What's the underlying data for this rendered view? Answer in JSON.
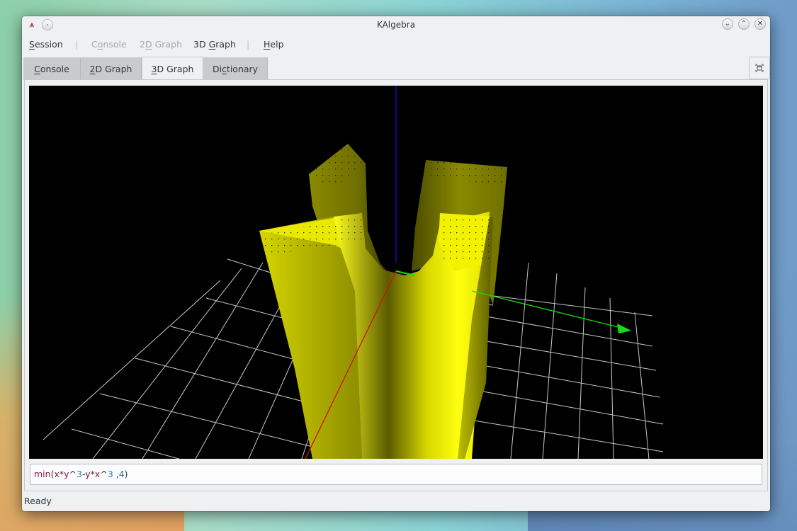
{
  "window": {
    "title": "KAlgebra",
    "app_icon": "kalgebra-logo-icon",
    "buttons": {
      "minimize": "⌄",
      "maximize": "⌃",
      "close": "✕"
    }
  },
  "menubar": {
    "items": [
      {
        "label": "Session",
        "mnemonic": "S",
        "rest": "ession",
        "enabled": true
      },
      {
        "label": "Console",
        "pre": "C",
        "mnemonic": "o",
        "rest": "nsole",
        "enabled": false
      },
      {
        "label": "2D Graph",
        "pre": "2",
        "mnemonic": "D",
        "rest": " Graph",
        "enabled": false
      },
      {
        "label": "3D Graph",
        "pre": "3D ",
        "mnemonic": "G",
        "rest": "raph",
        "enabled": true
      },
      {
        "label": "Help",
        "mnemonic": "H",
        "rest": "elp",
        "enabled": true
      }
    ],
    "separator": "|"
  },
  "tabs": {
    "active": "3D Graph",
    "items": [
      {
        "label": "Console",
        "mnemonic": "C",
        "rest": "onsole"
      },
      {
        "label": "2D Graph",
        "mnemonic": "2",
        "rest": "D Graph"
      },
      {
        "label": "3D Graph",
        "mnemonic": "3",
        "rest": "D Graph"
      },
      {
        "label": "Dictionary",
        "pre": "Di",
        "mnemonic": "c",
        "rest": "tionary"
      }
    ]
  },
  "graph3d": {
    "function": "min(x*y^3-y*x^3 ,4)",
    "colors": {
      "background": "#000000",
      "surface": "#ffff00",
      "x_axis": "#d01010",
      "y_axis": "#10e010",
      "z_axis": "#1010b0",
      "grid": "#c8c8c8"
    }
  },
  "expression": {
    "tokens": [
      {
        "t": "min",
        "c": "t-fn"
      },
      {
        "t": "(",
        "c": "t-op"
      },
      {
        "t": "x",
        "c": "t-var"
      },
      {
        "t": "*",
        "c": "t-op"
      },
      {
        "t": "y",
        "c": "t-var"
      },
      {
        "t": "^",
        "c": "t-op"
      },
      {
        "t": "3",
        "c": "t-num"
      },
      {
        "t": "-",
        "c": "t-op"
      },
      {
        "t": "y",
        "c": "t-var"
      },
      {
        "t": "*",
        "c": "t-op"
      },
      {
        "t": "x",
        "c": "t-var"
      },
      {
        "t": "^",
        "c": "t-op"
      },
      {
        "t": "3",
        "c": "t-num"
      },
      {
        "t": " ,",
        "c": "t-op"
      },
      {
        "t": "4",
        "c": "t-num"
      },
      {
        "t": ")",
        "c": "t-op"
      }
    ]
  },
  "status": {
    "text": "Ready"
  }
}
